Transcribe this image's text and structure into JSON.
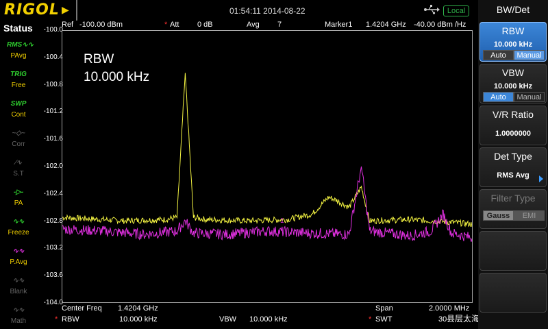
{
  "topbar": {
    "brand": "RIGOL",
    "datetime": "01:54:11 2014-08-22",
    "local_badge": "Local",
    "icons": [
      "usb-icon"
    ]
  },
  "status": {
    "title": "Status",
    "items": [
      {
        "label": "PAvg",
        "icon": "rms-avg-icon",
        "on": true
      },
      {
        "label": "Free",
        "icon": "trig-icon",
        "on": true
      },
      {
        "label": "Cont",
        "icon": "swp-icon",
        "on": true
      },
      {
        "label": "Corr",
        "icon": "corr-icon",
        "on": false
      },
      {
        "label": "S.T",
        "icon": "sweep-time-icon",
        "on": false
      },
      {
        "label": "PA",
        "icon": "preamp-icon",
        "on": true
      },
      {
        "label": "Freeze",
        "icon": "freeze-icon",
        "on": true
      },
      {
        "label": "P.Avg",
        "icon": "power-avg-icon",
        "on": true
      },
      {
        "label": "Blank",
        "icon": "blank-icon",
        "on": false
      },
      {
        "label": "Math",
        "icon": "math-icon",
        "on": false
      }
    ]
  },
  "header": {
    "ref_label": "Ref",
    "ref_value": "-100.00 dBm",
    "att_label": "Att",
    "att_value": "0 dB",
    "avg_label": "Avg",
    "avg_value": "7",
    "marker_label": "Marker1",
    "marker_freq": "1.4204 GHz",
    "marker_value": "-40.00 dBm /Hz"
  },
  "overlay": {
    "line1": "RBW",
    "line2": "10.000 kHz"
  },
  "footer": {
    "center_label": "Center Freq",
    "center_value": "1.4204 GHz",
    "span_label": "Span",
    "span_value": "2.0000 MHz",
    "rbw_label": "RBW",
    "rbw_value": "10.000 kHz",
    "vbw_label": "VBW",
    "vbw_value": "10.000 kHz",
    "swt_label": "SWT",
    "swt_value": "30"
  },
  "watermark": "县层太海路上的种花家",
  "menu": {
    "title": "BW/Det",
    "rbw": {
      "title": "RBW",
      "value": "10.000 kHz",
      "opt_auto": "Auto",
      "opt_manual": "Manual"
    },
    "vbw": {
      "title": "VBW",
      "value": "10.000 kHz",
      "opt_auto": "Auto",
      "opt_manual": "Manual"
    },
    "vr": {
      "title": "V/R Ratio",
      "value": "1.0000000"
    },
    "det": {
      "title": "Det Type",
      "value": "RMS Avg"
    },
    "filter": {
      "title": "Filter Type",
      "opt_gauss": "Gauss",
      "opt_emi": "EMI"
    }
  },
  "chart_data": {
    "type": "line",
    "y_tick_labels": [
      "-100.0",
      "-100.4",
      "-100.8",
      "-101.2",
      "-101.6",
      "-102.0",
      "-102.4",
      "-102.8",
      "-103.2",
      "-103.6",
      "-104.0"
    ],
    "ylim": [
      -104.0,
      -100.0
    ],
    "xlim_mhz": [
      1419.4,
      1421.4
    ],
    "grid": false,
    "colors": {
      "yellow": "#f5f542",
      "magenta": "#e030e0"
    },
    "series": [
      {
        "color": "yellow",
        "x": [
          1419.4,
          1419.6,
          1419.7,
          1419.9,
          1419.96,
          1420.0,
          1420.04,
          1420.1,
          1420.3,
          1420.5,
          1420.62,
          1420.7,
          1420.74,
          1420.8,
          1420.86,
          1420.9,
          1421.1,
          1421.3,
          1421.4
        ],
        "values": [
          -102.75,
          -102.78,
          -102.8,
          -102.78,
          -102.75,
          -100.62,
          -102.75,
          -102.78,
          -102.8,
          -102.78,
          -102.7,
          -102.45,
          -102.5,
          -102.6,
          -102.3,
          -102.8,
          -102.78,
          -102.82,
          -102.85
        ]
      },
      {
        "color": "magenta",
        "x": [
          1419.4,
          1419.6,
          1419.8,
          1419.96,
          1420.0,
          1420.04,
          1420.2,
          1420.4,
          1420.6,
          1420.8,
          1420.86,
          1420.9,
          1421.1,
          1421.2,
          1421.26,
          1421.3,
          1421.4
        ],
        "values": [
          -102.92,
          -102.95,
          -103.0,
          -102.95,
          -102.8,
          -102.98,
          -103.0,
          -102.95,
          -102.98,
          -103.0,
          -102.0,
          -102.95,
          -103.02,
          -102.95,
          -102.7,
          -102.98,
          -103.05
        ]
      }
    ]
  }
}
